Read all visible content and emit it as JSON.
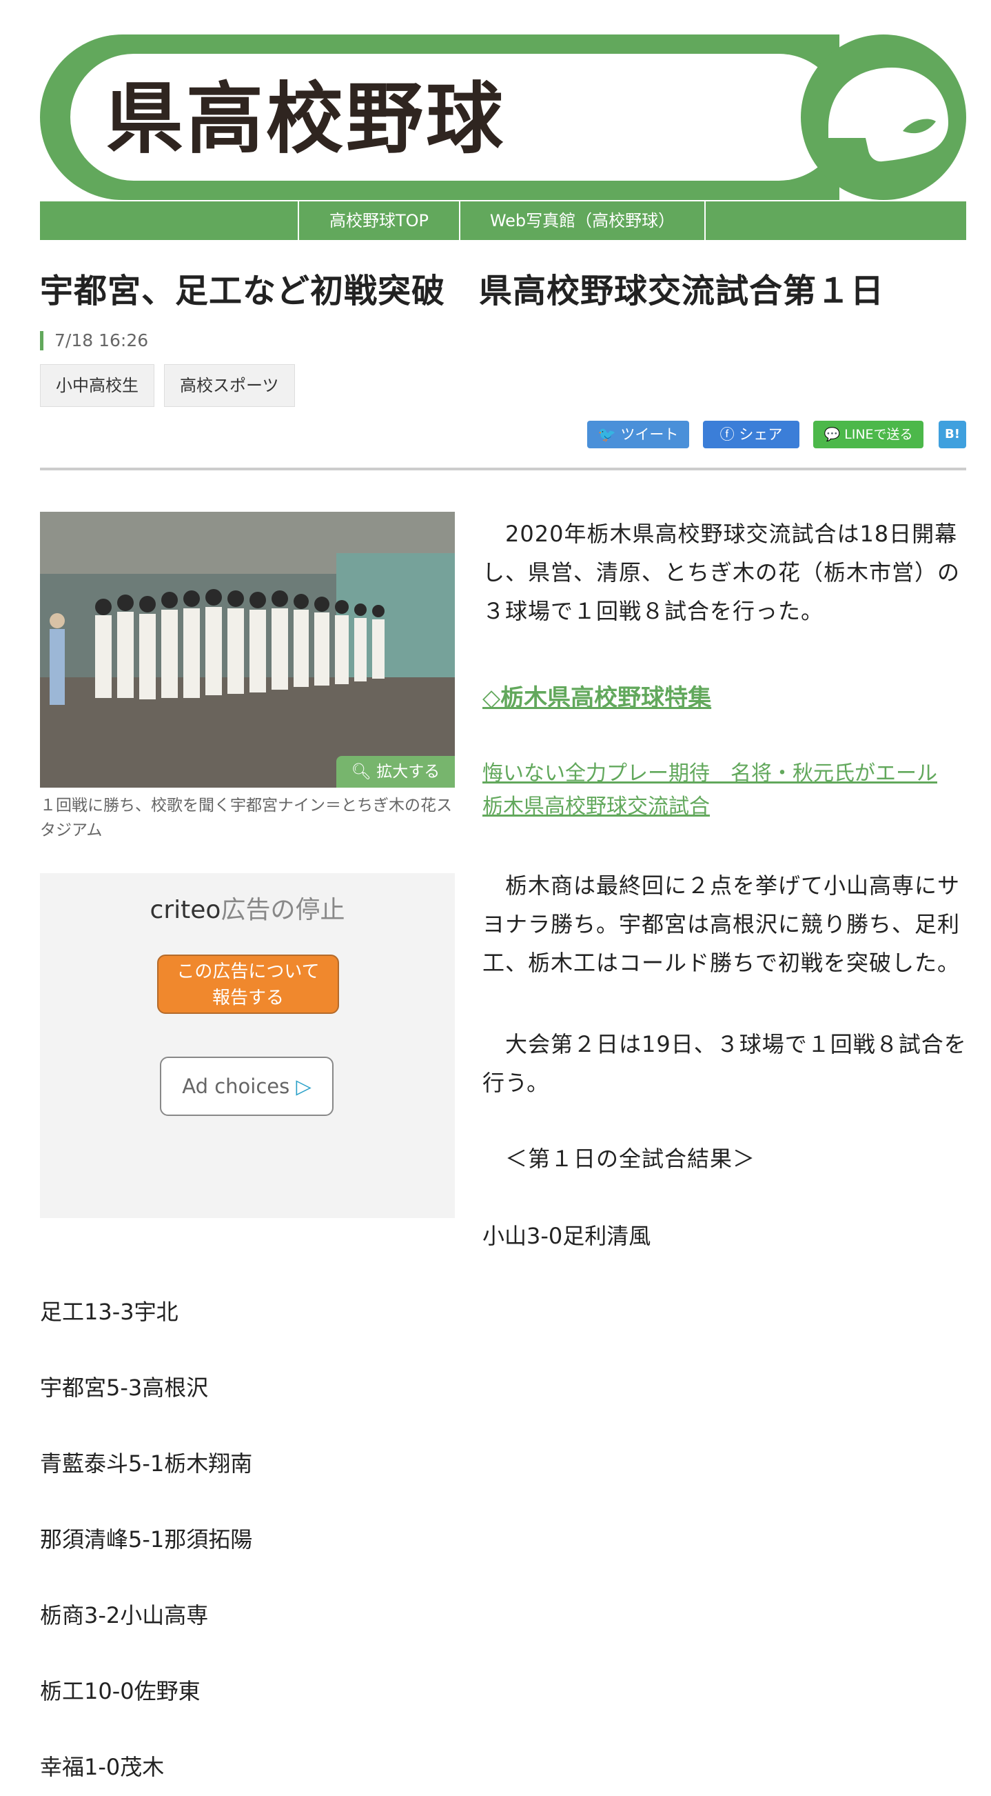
{
  "header": {
    "title": "県高校野球",
    "colors": {
      "brand": "#62a85c",
      "title": "#2f2520"
    }
  },
  "nav": {
    "items": [
      "高校野球TOP",
      "Web写真館（高校野球）"
    ]
  },
  "article": {
    "headline": "宇都宮、足工など初戦突破　県高校野球交流試合第１日",
    "date": "7/18 16:26",
    "tags": [
      "小中高校生",
      "高校スポーツ"
    ],
    "share": {
      "tweet": "ツイート",
      "facebook": "シェア",
      "line": "LINEで送る",
      "hatena": "B!"
    },
    "photo": {
      "zoom_label": "拡大する",
      "caption": "１回戦に勝ち、校歌を聞く宇都宮ナイン＝とちぎ木の花スタジアム"
    },
    "ad": {
      "logo_brand": "criteo",
      "logo_text": "広告の停止",
      "report_line1": "この広告について",
      "report_line2": "報告する",
      "choices": "Ad choices"
    },
    "intro": "　2020年栃木県高校野球交流試合は18日開幕し、県営、清原、とちぎ木の花（栃木市営）の３球場で１回戦８試合を行った。",
    "feature_link": "◇栃木県高校野球特集",
    "related_line1": "悔いない全力プレー期待　名将・秋元氏がエール",
    "related_line2": "栃木県高校野球交流試合",
    "para2": "　栃木商は最終回に２点を挙げて小山高専にサヨナラ勝ち。宇都宮は高根沢に競り勝ち、足利工、栃木工はコールド勝ちで初戦を突破した。",
    "para3": "　大会第２日は19日、３球場で１回戦８試合を行う。",
    "results_heading": "　＜第１日の全試合結果＞",
    "results": [
      "小山3-0足利清風",
      "足工13-3宇北",
      "宇都宮5-3高根沢",
      "青藍泰斗5-1栃木翔南",
      "那須清峰5-1那須拓陽",
      "栃商3-2小山高専",
      "栃工10-0佐野東",
      "幸福1-0茂木"
    ]
  }
}
